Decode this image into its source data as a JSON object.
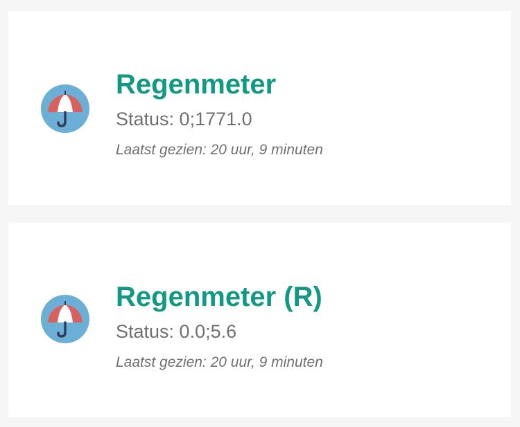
{
  "accent_color": "#139883",
  "devices": [
    {
      "name": "Regenmeter",
      "status": "Status: 0;1771.0",
      "last_seen": "Laatst gezien: 20 uur, 9 minuten",
      "icon": "umbrella-icon"
    },
    {
      "name": "Regenmeter (R)",
      "status": "Status: 0.0;5.6",
      "last_seen": "Laatst gezien: 20 uur, 9 minuten",
      "icon": "umbrella-icon"
    }
  ]
}
